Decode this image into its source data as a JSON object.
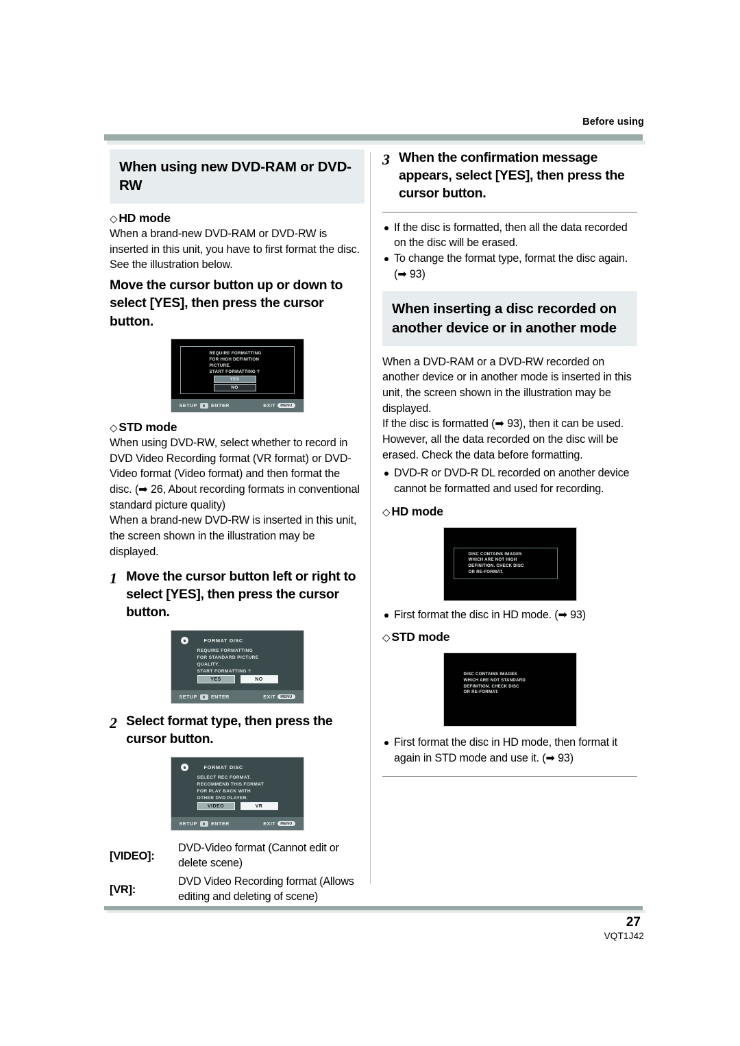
{
  "header": {
    "running_head": "Before using"
  },
  "left_column": {
    "heading": "When using new DVD-RAM or DVD-RW",
    "hd_mode_label": "HD mode",
    "hd_mode_body": "When a brand-new DVD-RAM or DVD-RW is inserted in this unit, you have to first format the disc. See the illustration below.",
    "hd_instruction": "Move the cursor button up or down to select [YES], then press the cursor button.",
    "hd_screen": {
      "line1": "REQUIRE FORMATTING",
      "line2": "FOR HIGH DEFINITION",
      "line3": "PICTURE.",
      "line4": "START FORMATTING ?",
      "yes": "YES",
      "no": "NO",
      "foot_setup": "SETUP",
      "foot_enter": "ENTER",
      "foot_exit": "EXIT",
      "foot_menu": "MENU"
    },
    "std_mode_label": "STD mode",
    "std_mode_body1": "When using DVD-RW, select whether to record in DVD Video Recording format (VR format) or DVD-Video format (Video format) and then format the disc. (➡ 26, About recording formats in conventional standard picture quality)",
    "std_mode_body2": "When a brand-new DVD-RW is inserted in this unit, the screen shown in the illustration may be displayed.",
    "step1": {
      "num": "1",
      "text": "Move the cursor button left or right to select [YES], then press the cursor button."
    },
    "step1_screen": {
      "title": "FORMAT DISC",
      "line1": "REQUIRE FORMATTING",
      "line2": "FOR STANDARD PICTURE",
      "line3": "QUALITY.",
      "line4": "START FORMATTING ?",
      "btn_selected": "YES",
      "btn_other": "NO",
      "foot_setup": "SETUP",
      "foot_enter": "ENTER",
      "foot_exit": "EXIT",
      "foot_menu": "MENU"
    },
    "step2": {
      "num": "2",
      "text": "Select format type, then press the cursor button."
    },
    "step2_screen": {
      "title": "FORMAT DISC",
      "line1": "SELECT REC FORMAT.",
      "line2": "RECOMMEND THIS FORMAT",
      "line3": "FOR PLAY BACK WITH",
      "line4": "OTHER DVD PLAYER.",
      "btn_selected": "VIDEO",
      "btn_other": "VR",
      "foot_setup": "SETUP",
      "foot_enter": "ENTER",
      "foot_exit": "EXIT",
      "foot_menu": "MENU"
    },
    "definitions": [
      {
        "term": "[VIDEO]:",
        "desc": "DVD-Video format (Cannot edit or delete scene)"
      },
      {
        "term": "[VR]:",
        "desc": "DVD Video Recording format (Allows editing and deleting of scene)"
      }
    ]
  },
  "right_column": {
    "step3": {
      "num": "3",
      "text": "When the confirmation message appears, select [YES], then press the cursor button."
    },
    "step3_bullets": [
      "If the disc is formatted, then all the data recorded on the disc will be erased.",
      "To change the format type, format the disc again. (➡ 93)"
    ],
    "heading2": "When inserting a disc recorded on another device or in another mode",
    "body1": "When a DVD-RAM or a DVD-RW recorded on another device or in another mode is inserted in this unit, the screen shown in the illustration may be displayed.",
    "body2": "If the disc is formatted (➡ 93), then it can be used. However, all the data recorded on the disc will be erased. Check the data before formatting.",
    "bullet1": "DVD-R or DVD-R DL recorded on another device cannot be formatted and used for recording.",
    "hd_mode_label": "HD mode",
    "hd_screen": {
      "line1": "DISC CONTAINS IMAGES",
      "line2": "WHICH ARE NOT HIGH",
      "line3": "DEFINITION. CHECK DISC",
      "line4": "OR RE-FORMAT."
    },
    "hd_bullet": "First format the disc in HD mode. (➡ 93)",
    "std_mode_label": "STD mode",
    "std_screen": {
      "line1": "DISC CONTAINS IMAGES",
      "line2": "WHICH ARE NOT STANDARD",
      "line3": "DEFINITION. CHECK DISC",
      "line4": "OR RE-FORMAT."
    },
    "std_bullet": "First format the disc in HD mode, then format it again in STD mode and use it. (➡ 93)"
  },
  "footer": {
    "page_number": "27",
    "doc_code": "VQT1J42"
  },
  "colors": {
    "rule_top": "#9aaba8",
    "heading_bg": "#e7ecee",
    "screen_std_bg": "#3b4a4c",
    "screen_footbar": "#5f7073"
  }
}
